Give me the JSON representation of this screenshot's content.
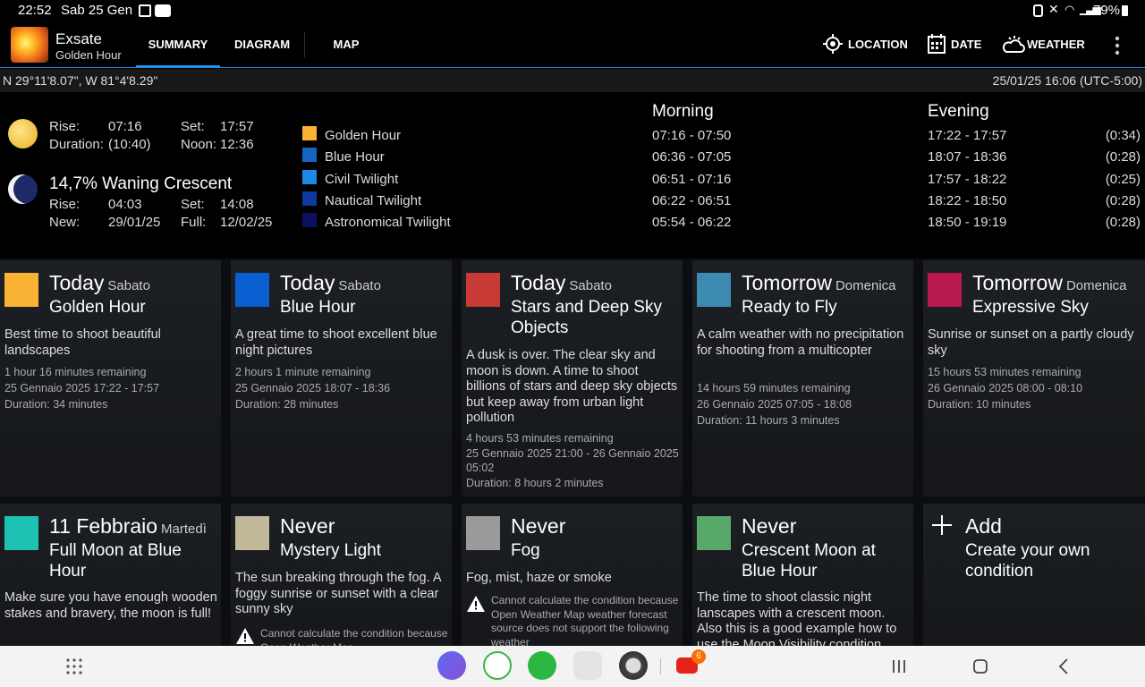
{
  "status": {
    "time": "22:52",
    "date": "Sab 25 Gen",
    "battery": "79%"
  },
  "app": {
    "title": "Exsate",
    "subtitle": "Golden Hour"
  },
  "tabs": [
    "SUMMARY",
    "DIAGRAM",
    "MAP"
  ],
  "actions": {
    "location": "LOCATION",
    "date": "DATE",
    "weather": "WEATHER"
  },
  "coords": "N 29°11'8.07\", W 81°4'8.29\"",
  "datetime": "25/01/25 16:06 (UTC-5:00)",
  "sun": {
    "rise_label": "Rise:",
    "rise": "07:16",
    "set_label": "Set:",
    "set": "17:57",
    "duration_label": "Duration:",
    "duration": "(10:40)",
    "noon_label": "Noon:",
    "noon": "12:36"
  },
  "moon": {
    "phase": "14,7% Waning Crescent",
    "rise_label": "Rise:",
    "rise": "04:03",
    "set_label": "Set:",
    "set": "14:08",
    "new_label": "New:",
    "new": "29/01/25",
    "full_label": "Full:",
    "full": "12/02/25"
  },
  "legend": [
    {
      "label": "Golden Hour",
      "color": "#f9b233"
    },
    {
      "label": "Blue Hour",
      "color": "#1565c0"
    },
    {
      "label": "Civil Twilight",
      "color": "#1e88e5"
    },
    {
      "label": "Nautical Twilight",
      "color": "#0d3aa0"
    },
    {
      "label": "Astronomical Twilight",
      "color": "#0a1260"
    }
  ],
  "morning": {
    "heading": "Morning",
    "rows": [
      "07:16 - 07:50",
      "06:36 - 07:05",
      "06:51 - 07:16",
      "06:22 - 06:51",
      "05:54 - 06:22"
    ]
  },
  "evening": {
    "heading": "Evening",
    "rows": [
      "17:22 - 17:57",
      "18:07 - 18:36",
      "17:57 - 18:22",
      "18:22 - 18:50",
      "18:50 - 19:19"
    ],
    "durations": [
      "(0:34)",
      "(0:28)",
      "(0:25)",
      "(0:28)",
      "(0:28)"
    ]
  },
  "cards": [
    {
      "when": "Today",
      "day": "Sabato",
      "name": "Golden Hour",
      "color": "#f9b233",
      "desc": "Best time to shoot beautiful landscapes",
      "meta": [
        "1 hour 16 minutes remaining",
        "25 Gennaio 2025 17:22 - 17:57",
        "Duration: 34 minutes"
      ]
    },
    {
      "when": "Today",
      "day": "Sabato",
      "name": "Blue Hour",
      "color": "#0a5fd1",
      "desc": "A great time to shoot excellent blue night pictures",
      "meta": [
        "2 hours 1 minute remaining",
        "25 Gennaio 2025 18:07 - 18:36",
        "Duration: 28 minutes"
      ]
    },
    {
      "when": "Today",
      "day": "Sabato",
      "name": "Stars and Deep Sky Objects",
      "color": "#c83a36",
      "desc": "A dusk is over. The clear sky and moon is down. A time to shoot billions of stars and deep sky objects but keep away from urban light pollution",
      "meta": [
        "4 hours 53 minutes remaining",
        "25 Gennaio 2025 21:00 - 26 Gennaio 2025 05:02",
        "Duration: 8 hours 2 minutes"
      ]
    },
    {
      "when": "Tomorrow",
      "day": "Domenica",
      "name": "Ready to Fly",
      "color": "#3d8bb0",
      "desc": "A calm weather with no precipitation for shooting from a multicopter",
      "meta": [
        "14 hours 59 minutes remaining",
        "26 Gennaio 2025 07:05 - 18:08",
        "Duration: 11 hours 3 minutes"
      ]
    },
    {
      "when": "Tomorrow",
      "day": "Domenica",
      "name": "Expressive Sky",
      "color": "#b81a4e",
      "desc": "Sunrise or sunset on a partly cloudy sky",
      "meta": [
        "15 hours 53 minutes remaining",
        "26 Gennaio 2025 08:00 - 08:10",
        "Duration: 10 minutes"
      ]
    },
    {
      "when": "11 Febbraio",
      "day": "Martedì",
      "name": "Full Moon at Blue Hour",
      "color": "#1ec2b4",
      "desc": "Make sure you have enough wooden stakes and bravery, the moon is full!",
      "meta": []
    },
    {
      "when": "Never",
      "day": "",
      "name": "Mystery Light",
      "color": "#c2b99a",
      "desc": "The sun breaking through the fog. A foggy sunrise or sunset with a clear sunny sky",
      "warn": "Cannot calculate the condition because Open Weather Map"
    },
    {
      "when": "Never",
      "day": "",
      "name": "Fog",
      "color": "#9a9a9a",
      "desc": "Fog, mist, haze or smoke",
      "warn": "Cannot calculate the condition because Open Weather Map weather forecast source does not support the following weather"
    },
    {
      "when": "Never",
      "day": "",
      "name": "Crescent Moon at Blue Hour",
      "color": "#58a86a",
      "desc": "The time to shoot classic night lanscapes with a crescent moon. Also this is a good example how to use the Moon Visibility condition"
    }
  ],
  "add": {
    "title": "Add",
    "subtitle": "Create your own condition"
  },
  "nav": {
    "youtube_badge": "6"
  }
}
